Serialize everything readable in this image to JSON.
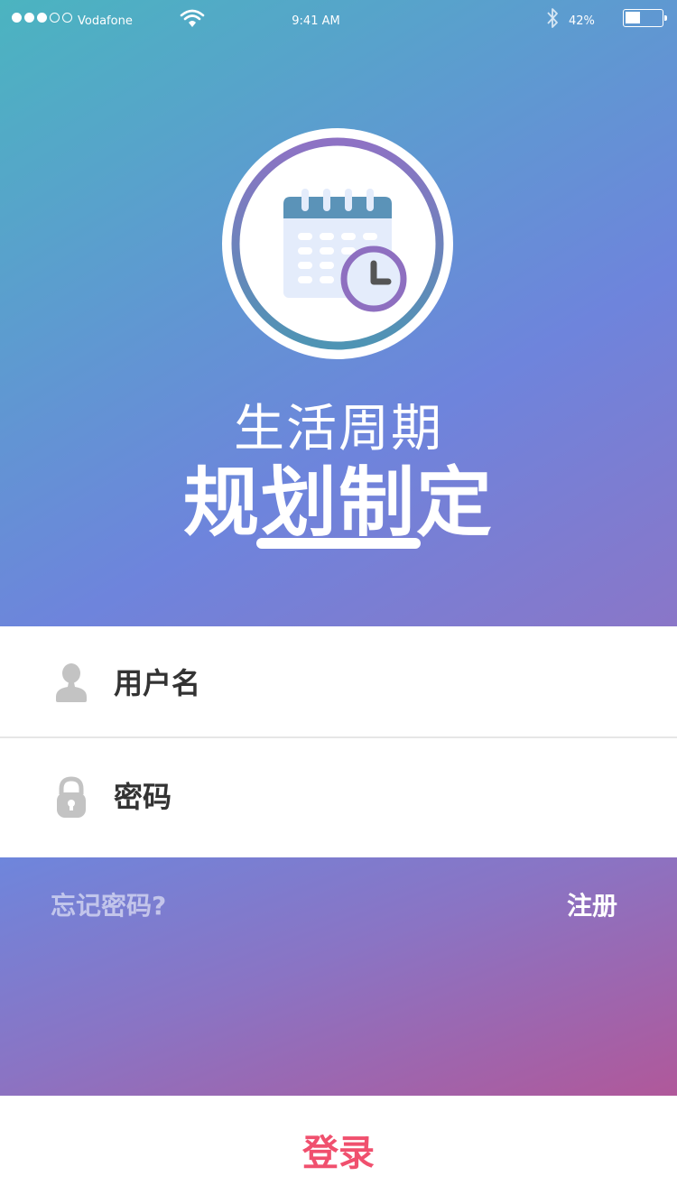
{
  "status_bar": {
    "carrier": "Vodafone",
    "time": "9:41 AM",
    "battery_percent": "42%",
    "battery_level": 0.42,
    "signal_bars_filled": 3,
    "signal_bars_total": 5,
    "icons": [
      "wifi-icon",
      "bluetooth-icon",
      "battery-icon"
    ]
  },
  "hero": {
    "logo_icon": "calendar-clock-icon",
    "title_line1": "生活周期",
    "title_line2": "规划制定"
  },
  "form": {
    "username_placeholder": "用户名",
    "username_icon": "user-icon",
    "password_placeholder": "密码",
    "password_icon": "lock-icon"
  },
  "links": {
    "forgot_password": "忘记密码?",
    "register": "注册"
  },
  "login_label": "登录",
  "colors": {
    "accent_login": "#f0506e",
    "hero_gradient": [
      "#4bb4c0",
      "#6e84dc",
      "#8a76c8"
    ],
    "band_gradient": [
      "#6e86dc",
      "#8a74c4",
      "#b0589a"
    ]
  }
}
